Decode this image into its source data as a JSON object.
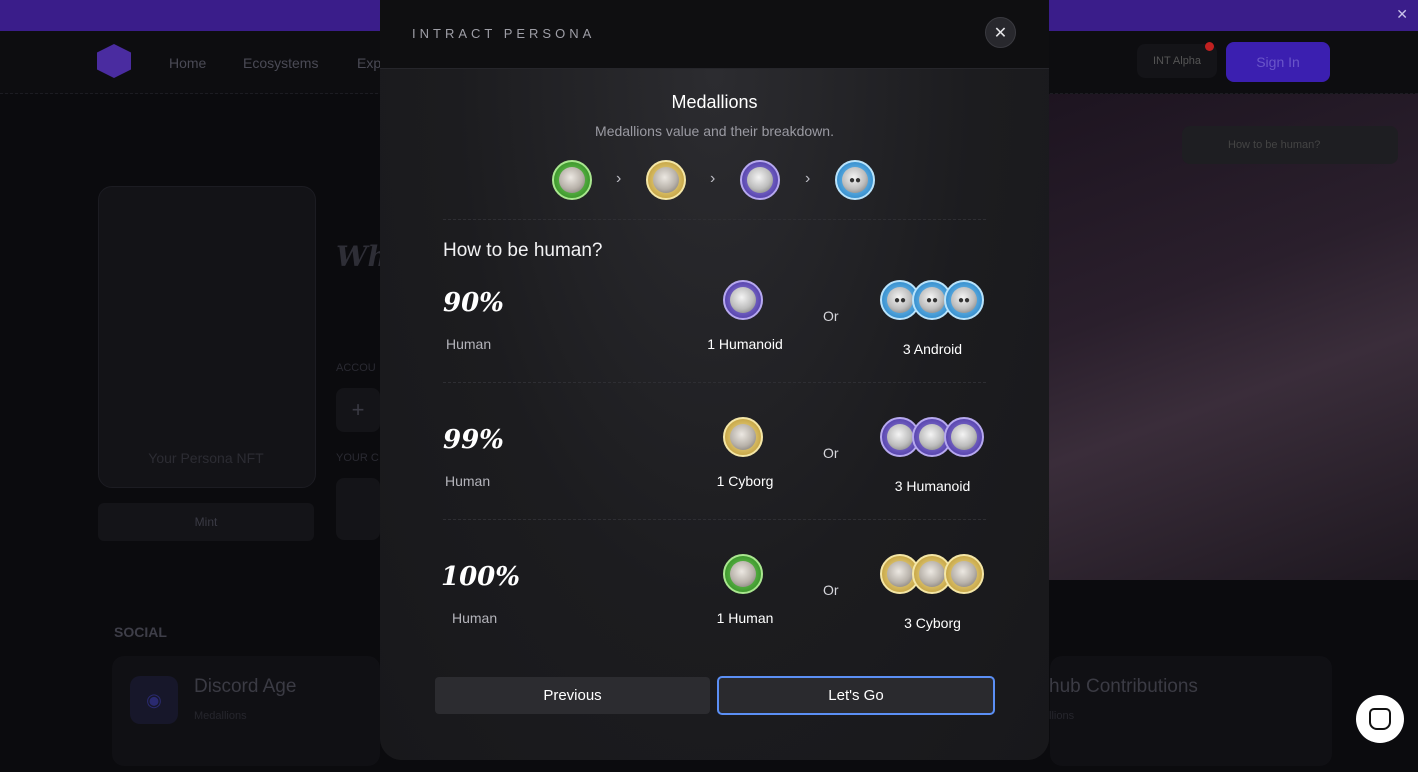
{
  "background": {
    "nav_links": [
      "Home",
      "Ecosystems",
      "Exp"
    ],
    "signin_label": "Sign In",
    "alpha_label": "INT Alpha",
    "how_to_pill": "How to be human?",
    "hero_heading": "Wh",
    "card_label": "Your Persona NFT",
    "mint_label": "Mint",
    "accounts_label": "ACCOU",
    "your_label": "YOUR C",
    "social_label": "SOCIAL",
    "social_cards": [
      {
        "title": "Discord Age",
        "sub": "Medallions"
      },
      {
        "title": "hub Contributions",
        "sub": "llions"
      }
    ]
  },
  "modal": {
    "title": "INTRACT PERSONA",
    "close_icon": "close-icon",
    "section_title": "Medallions",
    "section_subtitle": "Medallions value and their breakdown.",
    "progression": [
      "human",
      "cyborg",
      "humanoid",
      "android"
    ],
    "how_title": "How to be human?",
    "tiers": [
      {
        "percent": "90%",
        "label": "Human",
        "single_type": "humanoid",
        "single_label": "1 Humanoid",
        "or": "Or",
        "triple_type": "android",
        "triple_label": "3 Android"
      },
      {
        "percent": "99%",
        "label": "Human",
        "single_type": "cyborg",
        "single_label": "1 Cyborg",
        "or": "Or",
        "triple_type": "humanoid",
        "triple_label": "3 Humanoid"
      },
      {
        "percent": "100%",
        "label": "Human",
        "single_type": "human",
        "single_label": "1 Human",
        "or": "Or",
        "triple_type": "cyborg",
        "triple_label": "3 Cyborg"
      }
    ],
    "previous_label": "Previous",
    "go_label": "Let's Go"
  },
  "colors": {
    "human": "#4caf3a",
    "cyborg": "#e2c764",
    "humanoid": "#7a66d0",
    "android": "#5fb4ea",
    "accent": "#5b8ff5"
  }
}
